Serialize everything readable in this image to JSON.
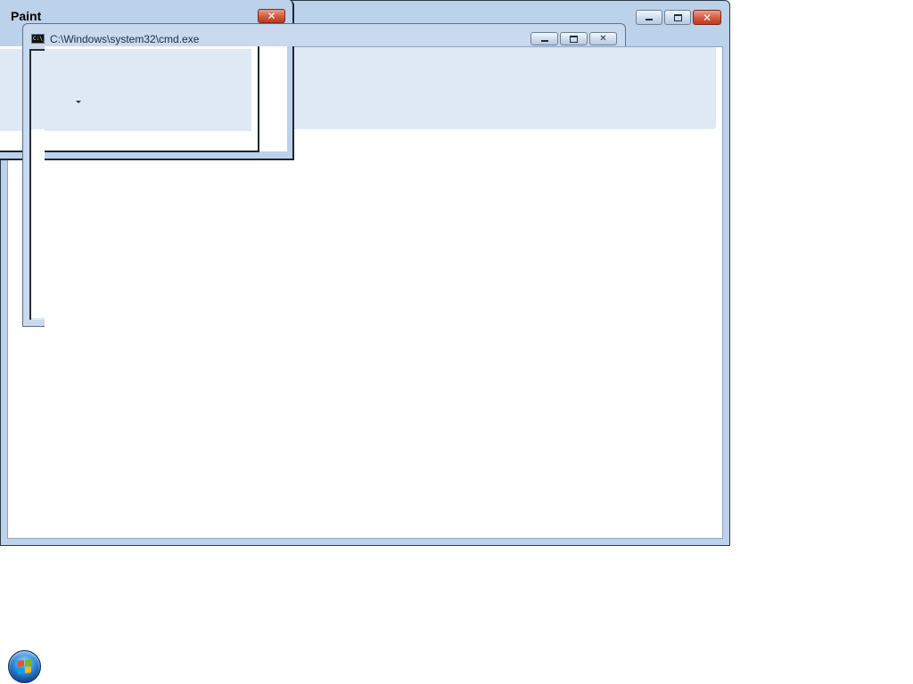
{
  "desktop": {
    "background": "#ffffff"
  },
  "main_window": {
    "frame_color": "#bcd1ea",
    "buttons": {
      "minimize_icon": "minimize-icon",
      "maximize_icon": "maximize-icon",
      "close_icon": "close-icon"
    }
  },
  "paint_window": {
    "title": "Paint",
    "close_icon": "close-icon"
  },
  "cmd_window": {
    "title": "C:\\Windows\\system32\\cmd.exe",
    "icon": "console-icon",
    "icon_text": "C:\\_",
    "buttons": {
      "minimize_icon": "minimize-icon",
      "maximize_icon": "maximize-icon",
      "close_icon": "close-icon"
    }
  },
  "taskbar": {
    "start_button_icon": "windows-logo-icon",
    "brand_colors": {
      "red": "#f25022",
      "green": "#7fba00",
      "blue": "#00a4ef",
      "yellow": "#ffb900"
    }
  }
}
